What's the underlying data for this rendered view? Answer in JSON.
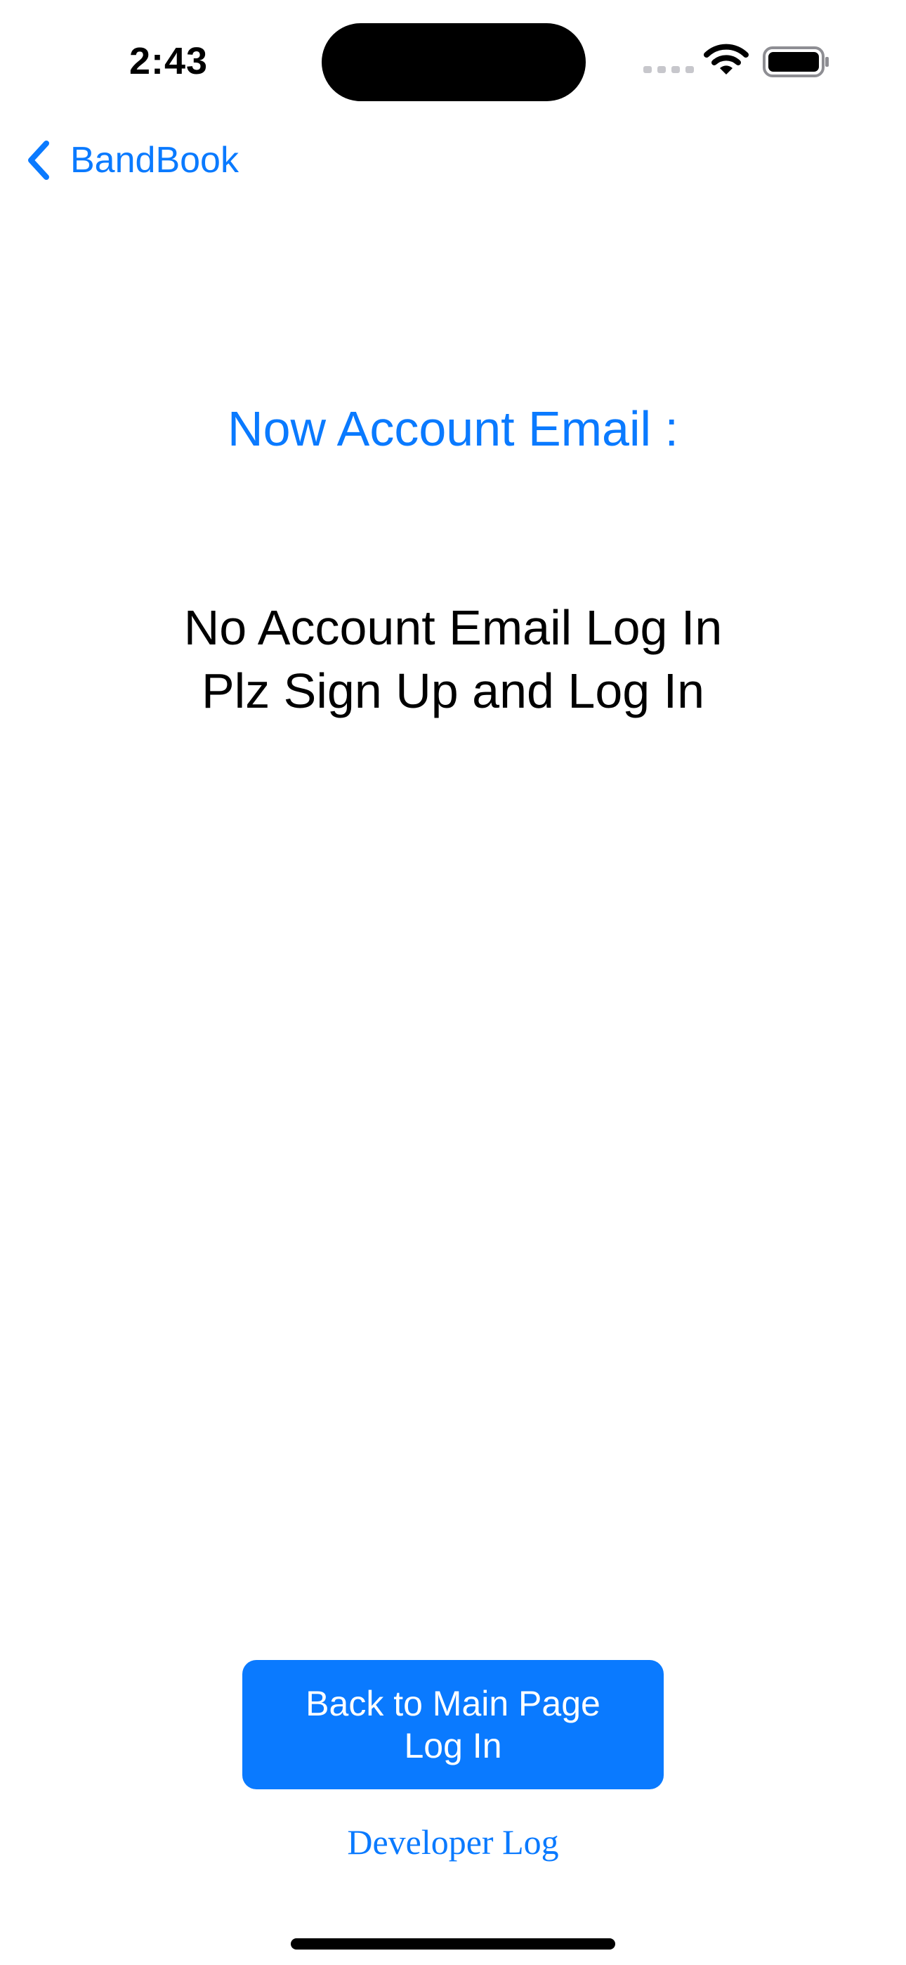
{
  "status_bar": {
    "time": "2:43",
    "signal_icon": "cellular-signal-icon",
    "wifi_icon": "wifi-icon",
    "battery_icon": "battery-icon"
  },
  "nav": {
    "back_label": "BandBook",
    "back_icon": "chevron-left-icon"
  },
  "account": {
    "title": "Now Account Email :",
    "message_line1": "No Account Email Log In",
    "message_line2": "Plz Sign Up and Log In"
  },
  "actions": {
    "main_button_line1": "Back to Main Page",
    "main_button_line2": "Log In",
    "developer_log": "Developer Log"
  },
  "colors": {
    "accent": "#0A7AFF",
    "text": "#000000",
    "background": "#FFFFFF"
  }
}
